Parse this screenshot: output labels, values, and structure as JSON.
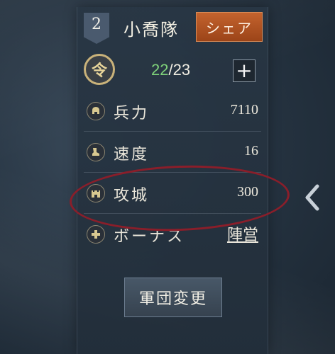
{
  "squad": {
    "number": "2",
    "name": "小喬隊",
    "share_label": "シェア"
  },
  "orders": {
    "icon_glyph": "令",
    "current": "22",
    "separator": "/",
    "max": "23",
    "plus_label": "+"
  },
  "stats": [
    {
      "icon": "helmet-icon",
      "label": "兵力",
      "value": "7110"
    },
    {
      "icon": "boot-icon",
      "label": "速度",
      "value": "16"
    },
    {
      "icon": "castle-icon",
      "label": "攻城",
      "value": "300"
    },
    {
      "icon": "plus-icon",
      "label": "ボーナス",
      "value": "陣営"
    }
  ],
  "change_button_label": "軍団変更",
  "colors": {
    "share_button": "#b5542a",
    "orders_current": "#7fd27a",
    "highlight_ring": "#8a1e2a",
    "icon_gold": "#c9b27a"
  }
}
